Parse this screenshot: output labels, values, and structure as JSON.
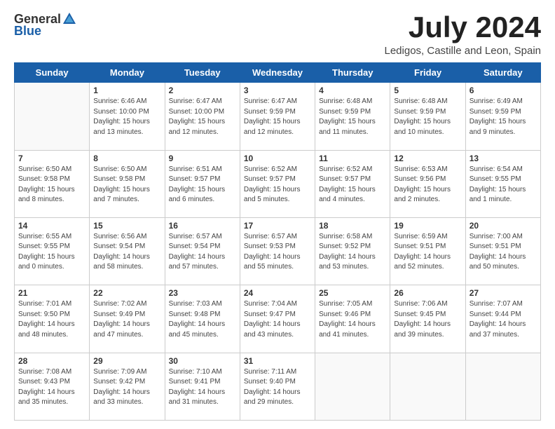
{
  "logo": {
    "general": "General",
    "blue": "Blue"
  },
  "title": "July 2024",
  "location": "Ledigos, Castille and Leon, Spain",
  "days_of_week": [
    "Sunday",
    "Monday",
    "Tuesday",
    "Wednesday",
    "Thursday",
    "Friday",
    "Saturday"
  ],
  "weeks": [
    [
      {
        "day": "",
        "info": ""
      },
      {
        "day": "1",
        "info": "Sunrise: 6:46 AM\nSunset: 10:00 PM\nDaylight: 15 hours\nand 13 minutes."
      },
      {
        "day": "2",
        "info": "Sunrise: 6:47 AM\nSunset: 10:00 PM\nDaylight: 15 hours\nand 12 minutes."
      },
      {
        "day": "3",
        "info": "Sunrise: 6:47 AM\nSunset: 9:59 PM\nDaylight: 15 hours\nand 12 minutes."
      },
      {
        "day": "4",
        "info": "Sunrise: 6:48 AM\nSunset: 9:59 PM\nDaylight: 15 hours\nand 11 minutes."
      },
      {
        "day": "5",
        "info": "Sunrise: 6:48 AM\nSunset: 9:59 PM\nDaylight: 15 hours\nand 10 minutes."
      },
      {
        "day": "6",
        "info": "Sunrise: 6:49 AM\nSunset: 9:59 PM\nDaylight: 15 hours\nand 9 minutes."
      }
    ],
    [
      {
        "day": "7",
        "info": "Sunrise: 6:50 AM\nSunset: 9:58 PM\nDaylight: 15 hours\nand 8 minutes."
      },
      {
        "day": "8",
        "info": "Sunrise: 6:50 AM\nSunset: 9:58 PM\nDaylight: 15 hours\nand 7 minutes."
      },
      {
        "day": "9",
        "info": "Sunrise: 6:51 AM\nSunset: 9:57 PM\nDaylight: 15 hours\nand 6 minutes."
      },
      {
        "day": "10",
        "info": "Sunrise: 6:52 AM\nSunset: 9:57 PM\nDaylight: 15 hours\nand 5 minutes."
      },
      {
        "day": "11",
        "info": "Sunrise: 6:52 AM\nSunset: 9:57 PM\nDaylight: 15 hours\nand 4 minutes."
      },
      {
        "day": "12",
        "info": "Sunrise: 6:53 AM\nSunset: 9:56 PM\nDaylight: 15 hours\nand 2 minutes."
      },
      {
        "day": "13",
        "info": "Sunrise: 6:54 AM\nSunset: 9:55 PM\nDaylight: 15 hours\nand 1 minute."
      }
    ],
    [
      {
        "day": "14",
        "info": "Sunrise: 6:55 AM\nSunset: 9:55 PM\nDaylight: 15 hours\nand 0 minutes."
      },
      {
        "day": "15",
        "info": "Sunrise: 6:56 AM\nSunset: 9:54 PM\nDaylight: 14 hours\nand 58 minutes."
      },
      {
        "day": "16",
        "info": "Sunrise: 6:57 AM\nSunset: 9:54 PM\nDaylight: 14 hours\nand 57 minutes."
      },
      {
        "day": "17",
        "info": "Sunrise: 6:57 AM\nSunset: 9:53 PM\nDaylight: 14 hours\nand 55 minutes."
      },
      {
        "day": "18",
        "info": "Sunrise: 6:58 AM\nSunset: 9:52 PM\nDaylight: 14 hours\nand 53 minutes."
      },
      {
        "day": "19",
        "info": "Sunrise: 6:59 AM\nSunset: 9:51 PM\nDaylight: 14 hours\nand 52 minutes."
      },
      {
        "day": "20",
        "info": "Sunrise: 7:00 AM\nSunset: 9:51 PM\nDaylight: 14 hours\nand 50 minutes."
      }
    ],
    [
      {
        "day": "21",
        "info": "Sunrise: 7:01 AM\nSunset: 9:50 PM\nDaylight: 14 hours\nand 48 minutes."
      },
      {
        "day": "22",
        "info": "Sunrise: 7:02 AM\nSunset: 9:49 PM\nDaylight: 14 hours\nand 47 minutes."
      },
      {
        "day": "23",
        "info": "Sunrise: 7:03 AM\nSunset: 9:48 PM\nDaylight: 14 hours\nand 45 minutes."
      },
      {
        "day": "24",
        "info": "Sunrise: 7:04 AM\nSunset: 9:47 PM\nDaylight: 14 hours\nand 43 minutes."
      },
      {
        "day": "25",
        "info": "Sunrise: 7:05 AM\nSunset: 9:46 PM\nDaylight: 14 hours\nand 41 minutes."
      },
      {
        "day": "26",
        "info": "Sunrise: 7:06 AM\nSunset: 9:45 PM\nDaylight: 14 hours\nand 39 minutes."
      },
      {
        "day": "27",
        "info": "Sunrise: 7:07 AM\nSunset: 9:44 PM\nDaylight: 14 hours\nand 37 minutes."
      }
    ],
    [
      {
        "day": "28",
        "info": "Sunrise: 7:08 AM\nSunset: 9:43 PM\nDaylight: 14 hours\nand 35 minutes."
      },
      {
        "day": "29",
        "info": "Sunrise: 7:09 AM\nSunset: 9:42 PM\nDaylight: 14 hours\nand 33 minutes."
      },
      {
        "day": "30",
        "info": "Sunrise: 7:10 AM\nSunset: 9:41 PM\nDaylight: 14 hours\nand 31 minutes."
      },
      {
        "day": "31",
        "info": "Sunrise: 7:11 AM\nSunset: 9:40 PM\nDaylight: 14 hours\nand 29 minutes."
      },
      {
        "day": "",
        "info": ""
      },
      {
        "day": "",
        "info": ""
      },
      {
        "day": "",
        "info": ""
      }
    ]
  ]
}
